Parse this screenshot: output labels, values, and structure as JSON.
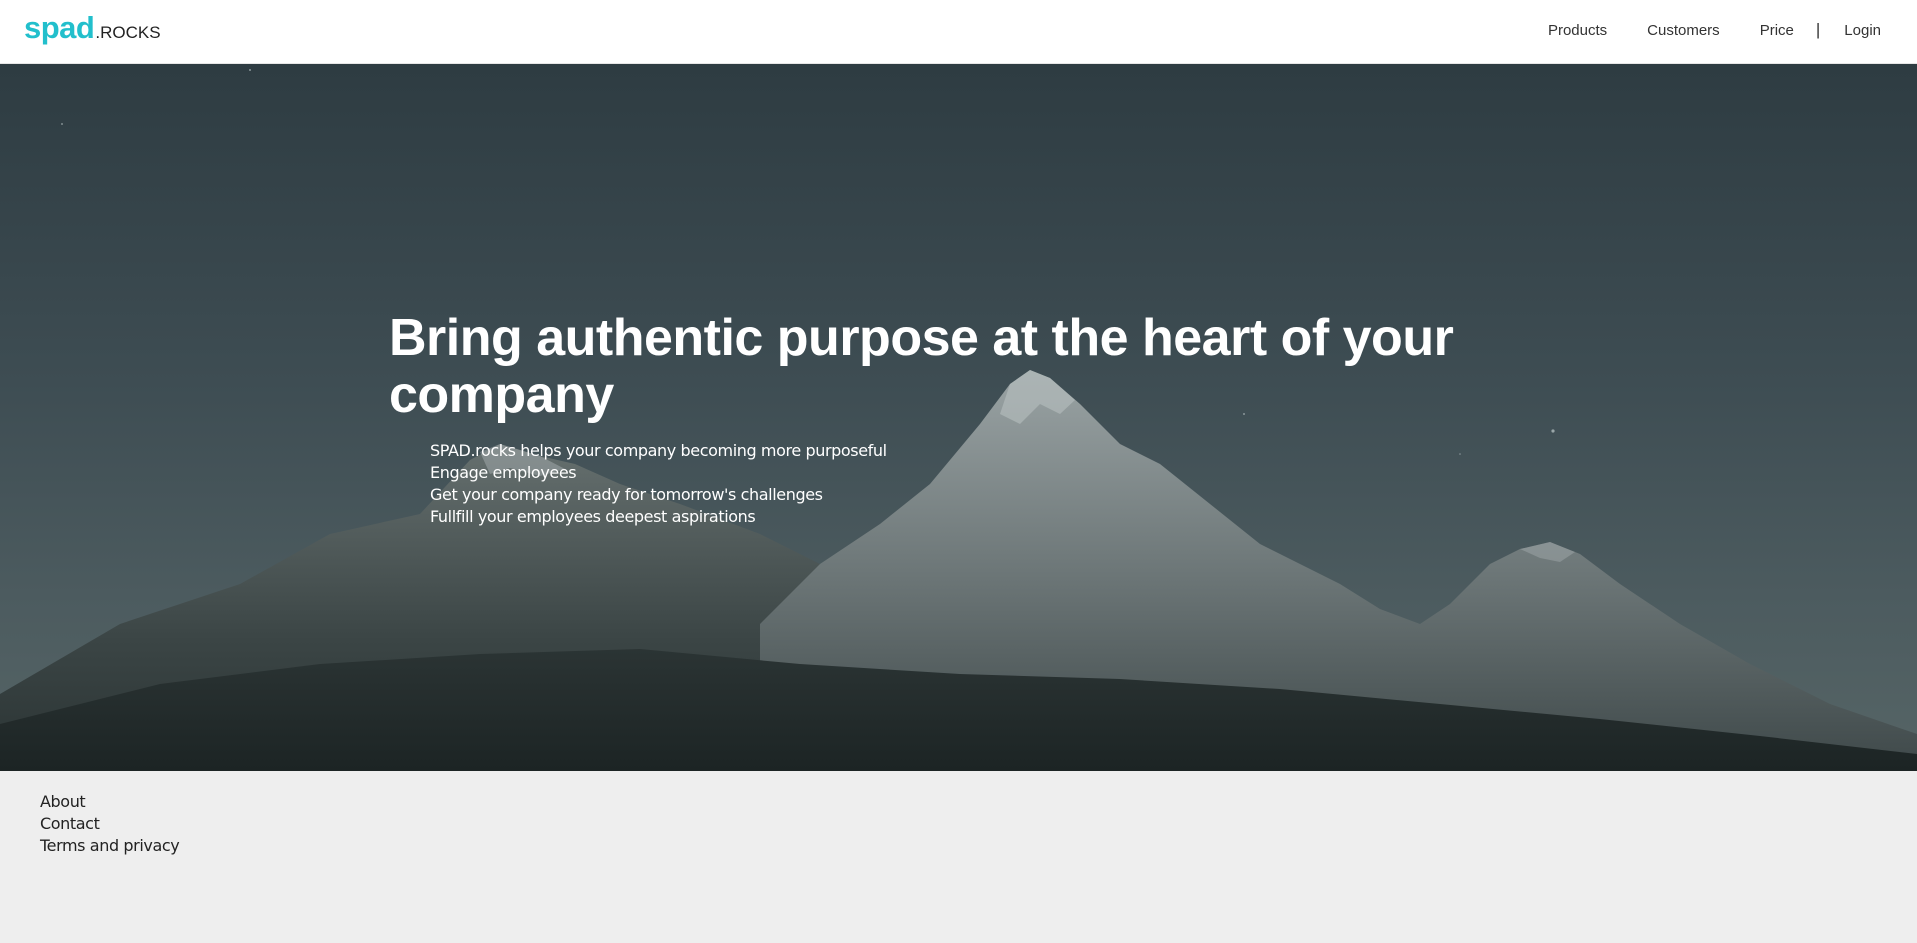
{
  "header": {
    "logo_main": "spad",
    "logo_suffix": ".ROCKS",
    "nav": {
      "products": "Products",
      "customers": "Customers",
      "price": "Price",
      "separator": "|",
      "login": "Login"
    }
  },
  "hero": {
    "title": "Bring authentic purpose at the heart of your company",
    "points": [
      "SPAD.rocks helps your company becoming more purposeful",
      "Engage employees",
      "Get your company ready for tomorrow's challenges",
      "Fullfill your employees deepest aspirations"
    ]
  },
  "footer": {
    "links": [
      "About",
      "Contact",
      "Terms and privacy"
    ]
  },
  "colors": {
    "brand": "#22bfcc",
    "footer_bg": "#eeeeee",
    "hero_sky": "#3b4a50"
  }
}
